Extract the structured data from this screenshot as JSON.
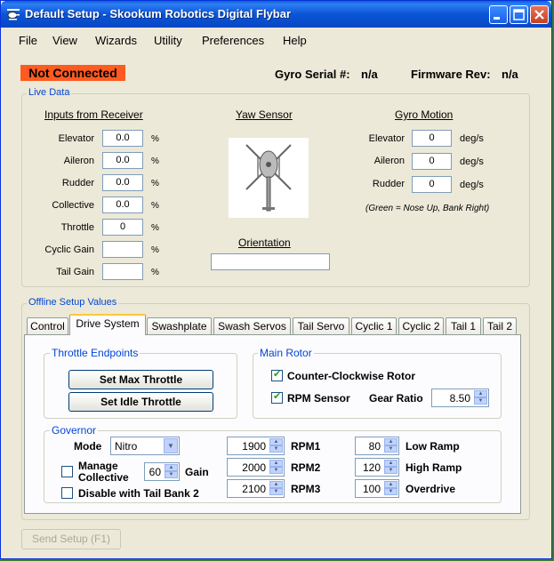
{
  "window": {
    "title": "Default Setup - Skookum Robotics Digital Flybar"
  },
  "menu": [
    "File",
    "View",
    "Wizards",
    "Utility",
    "Preferences",
    "Help"
  ],
  "status": {
    "connection": "Not Connected",
    "gyro_serial_label": "Gyro Serial #:",
    "gyro_serial_value": "n/a",
    "firmware_label": "Firmware Rev:",
    "firmware_value": "n/a",
    "connection_color": "#ff5a1f"
  },
  "live_data": {
    "label": "Live Data",
    "inputs": {
      "heading": "Inputs from Receiver",
      "rows": [
        {
          "label": "Elevator",
          "value": "0.0",
          "unit": "%"
        },
        {
          "label": "Aileron",
          "value": "0.0",
          "unit": "%"
        },
        {
          "label": "Rudder",
          "value": "0.0",
          "unit": "%"
        },
        {
          "label": "Collective",
          "value": "0.0",
          "unit": "%"
        },
        {
          "label": "Throttle",
          "value": "0",
          "unit": "%"
        },
        {
          "label": "Cyclic Gain",
          "value": "",
          "unit": "%"
        },
        {
          "label": "Tail Gain",
          "value": "",
          "unit": "%"
        }
      ]
    },
    "yaw_sensor": {
      "heading": "Yaw Sensor"
    },
    "orientation": {
      "heading": "Orientation",
      "value": ""
    },
    "gyro_motion": {
      "heading": "Gyro Motion",
      "rows": [
        {
          "label": "Elevator",
          "value": "0",
          "unit": "deg/s"
        },
        {
          "label": "Aileron",
          "value": "0",
          "unit": "deg/s"
        },
        {
          "label": "Rudder",
          "value": "0",
          "unit": "deg/s"
        }
      ],
      "note": "(Green = Nose Up, Bank Right)"
    }
  },
  "offline": {
    "label": "Offline Setup Values",
    "tabs": [
      "Control",
      "Drive System",
      "Swashplate",
      "Swash Servos",
      "Tail Servo",
      "Cyclic 1",
      "Cyclic 2",
      "Tail 1",
      "Tail 2"
    ],
    "active_tab": "Drive System",
    "throttle_endpoints": {
      "label": "Throttle Endpoints",
      "set_max": "Set Max Throttle",
      "set_idle": "Set Idle Throttle"
    },
    "main_rotor": {
      "label": "Main Rotor",
      "ccw_label": "Counter-Clockwise Rotor",
      "ccw_checked": true,
      "rpm_sensor_label": "RPM Sensor",
      "rpm_sensor_checked": true,
      "gear_ratio_label": "Gear Ratio",
      "gear_ratio_value": "8.50"
    },
    "governor": {
      "label": "Governor",
      "mode_label": "Mode",
      "mode_value": "Nitro",
      "manage_collective_label_1": "Manage",
      "manage_collective_label_2": "Collective",
      "manage_collective_checked": false,
      "gain_value": "60",
      "gain_label": "Gain",
      "disable_tail_bank_label": "Disable with Tail Bank 2",
      "disable_tail_bank_checked": false,
      "rpm": [
        {
          "value": "1900",
          "label": "RPM1"
        },
        {
          "value": "2000",
          "label": "RPM2"
        },
        {
          "value": "2100",
          "label": "RPM3"
        }
      ],
      "ramps": [
        {
          "value": "80",
          "label": "Low Ramp"
        },
        {
          "value": "120",
          "label": "High Ramp"
        },
        {
          "value": "100",
          "label": "Overdrive"
        }
      ]
    }
  },
  "send_setup": "Send Setup (F1)"
}
